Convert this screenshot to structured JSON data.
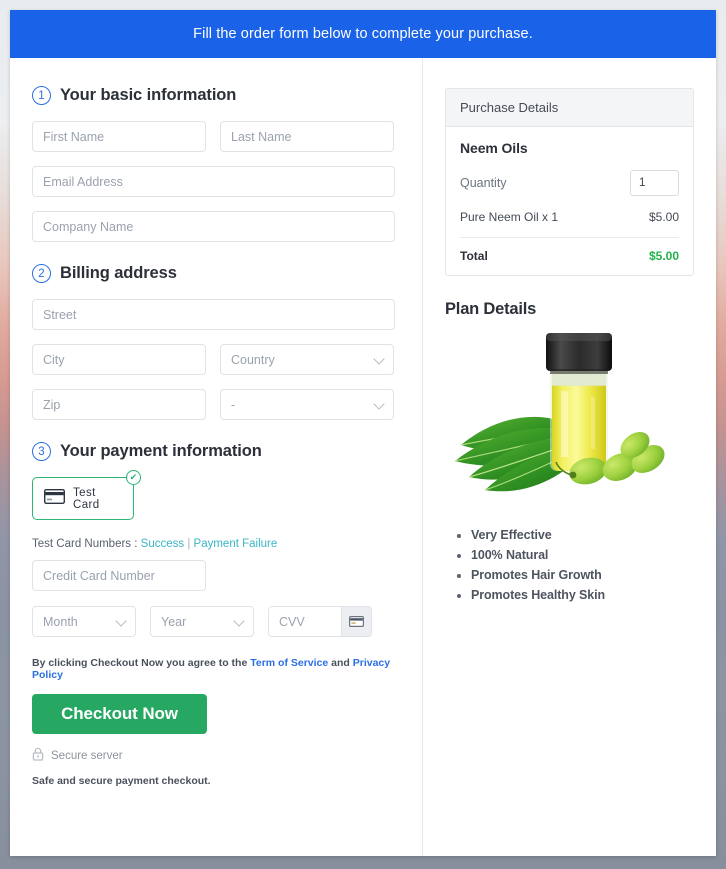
{
  "banner": {
    "text": "Fill the order form below to complete your purchase."
  },
  "sections": {
    "basic": {
      "step": "1",
      "title": "Your basic information",
      "first_name_placeholder": "First Name",
      "last_name_placeholder": "Last Name",
      "email_placeholder": "Email Address",
      "company_placeholder": "Company Name"
    },
    "billing": {
      "step": "2",
      "title": "Billing address",
      "street_placeholder": "Street",
      "city_placeholder": "City",
      "country_placeholder": "Country",
      "zip_placeholder": "Zip",
      "state_placeholder": "-"
    },
    "payment": {
      "step": "3",
      "title": "Your payment information",
      "tile_label": "Test  Card",
      "check_glyph": "✔",
      "test_numbers_label": "Test Card Numbers :",
      "success_link": "Success",
      "separator": "|",
      "failure_link": "Payment Failure",
      "card_number_placeholder": "Credit Card Number",
      "month_placeholder": "Month",
      "year_placeholder": "Year",
      "cvv_placeholder": "CVV",
      "terms_prefix": "By clicking Checkout Now you agree to the",
      "terms_link": "Term of Service",
      "terms_and": "and",
      "privacy_link": "Privacy Policy",
      "checkout_label": "Checkout Now",
      "secure_label": "Secure server",
      "safe_note": "Safe and secure payment checkout."
    }
  },
  "purchase": {
    "header": "Purchase Details",
    "product_name": "Neem Oils",
    "quantity_label": "Quantity",
    "quantity_value": "1",
    "line_item_label": "Pure Neem Oil x 1",
    "line_item_amount": "$5.00",
    "total_label": "Total",
    "total_amount": "$5.00"
  },
  "plan": {
    "title": "Plan Details",
    "image_alt": "neem-oil-bottle-with-leaves-image",
    "features": [
      "Very Effective",
      "100% Natural",
      "Promotes Hair Growth",
      "Promotes Healthy Skin"
    ]
  },
  "colors": {
    "banner_blue": "#1a62e8",
    "checkout_green": "#27a862",
    "tile_green": "#2bb673",
    "total_green": "#22b14c",
    "link_teal": "#3ab5c4",
    "link_blue": "#2b6fe4"
  }
}
